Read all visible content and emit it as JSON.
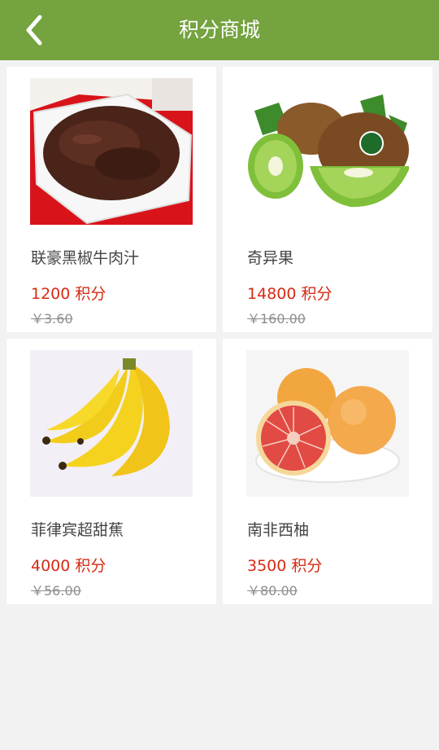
{
  "header": {
    "title": "积分商城",
    "back_icon": "chevron-left-icon"
  },
  "theme": {
    "header_bg": "#74a33f",
    "points_color": "#d62b14",
    "price_color": "#8d8d8d"
  },
  "products": [
    {
      "name": "联豪黑椒牛肉汁",
      "points": "1200 积分",
      "price": "￥3.60",
      "image": "beef-sauce-image"
    },
    {
      "name": "奇异果",
      "points": "14800 积分",
      "price": "￥160.00",
      "image": "kiwi-image"
    },
    {
      "name": "菲律宾超甜蕉",
      "points": "4000 积分",
      "price": "￥56.00",
      "image": "banana-image"
    },
    {
      "name": "南非西柚",
      "points": "3500 积分",
      "price": "￥80.00",
      "image": "grapefruit-image"
    }
  ]
}
